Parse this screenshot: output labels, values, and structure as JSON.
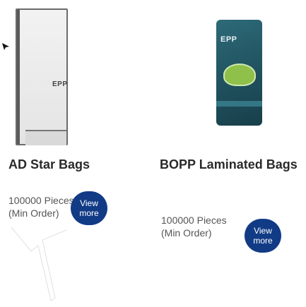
{
  "products": [
    {
      "title": "AD Star Bags",
      "quantity": "100000 Pieces (Min Order)",
      "button_label": "View more",
      "image_logo": "EPP"
    },
    {
      "title": "BOPP Laminated Bags",
      "quantity": "100000 Pieces (Min Order)",
      "button_label": "View more",
      "image_logo": "EPP"
    }
  ],
  "colors": {
    "button_bg": "#123b86",
    "button_text": "#ffffff",
    "title": "#2a2a2a",
    "text": "#555555"
  },
  "icons": [
    "arrow-pointer-icon"
  ]
}
